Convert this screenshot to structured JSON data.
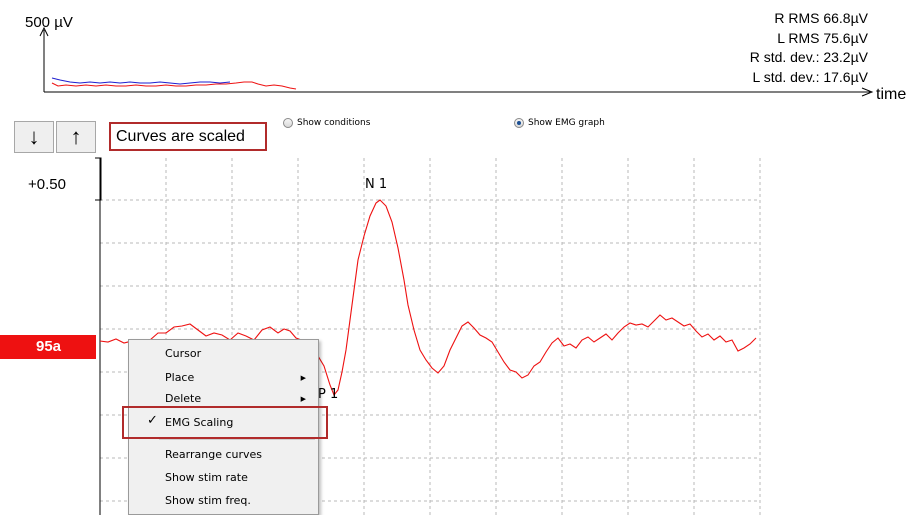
{
  "emg": {
    "y_label": "500 µV",
    "x_label": "time",
    "stats": [
      "R RMS 66.8µV",
      "L RMS 75.6µV",
      "R std. dev.: 23.2µV",
      "L std. dev.: 17.6µV"
    ],
    "colors": {
      "right": "#ee1111",
      "left": "#1f1fd0"
    }
  },
  "toolbar": {
    "down_arrow": "↓",
    "up_arrow": "↑",
    "status_text": "Curves are scaled",
    "show_conditions": "Show conditions",
    "show_conditions_selected": false,
    "show_emg_graph": "Show EMG graph",
    "show_emg_graph_selected": true
  },
  "graph": {
    "scale_value": "+0.50",
    "curve_label": "95a",
    "curve_color": "#ee1111",
    "peak_n1": "N 1",
    "peak_p1": "P 1"
  },
  "context_menu": {
    "items": [
      {
        "label": "Cursor",
        "submenu": false,
        "checked": false
      },
      {
        "label": "Place",
        "submenu": true,
        "checked": false
      },
      {
        "label": "Delete",
        "submenu": true,
        "checked": false
      },
      {
        "label": "EMG Scaling",
        "submenu": false,
        "checked": true
      },
      {
        "label": "Rearrange curves",
        "submenu": false,
        "checked": false
      },
      {
        "label": "Show stim rate",
        "submenu": false,
        "checked": false
      },
      {
        "label": "Show stim freq.",
        "submenu": false,
        "checked": false
      }
    ],
    "submenu_glyph": "▶",
    "check_glyph": "✓"
  }
}
